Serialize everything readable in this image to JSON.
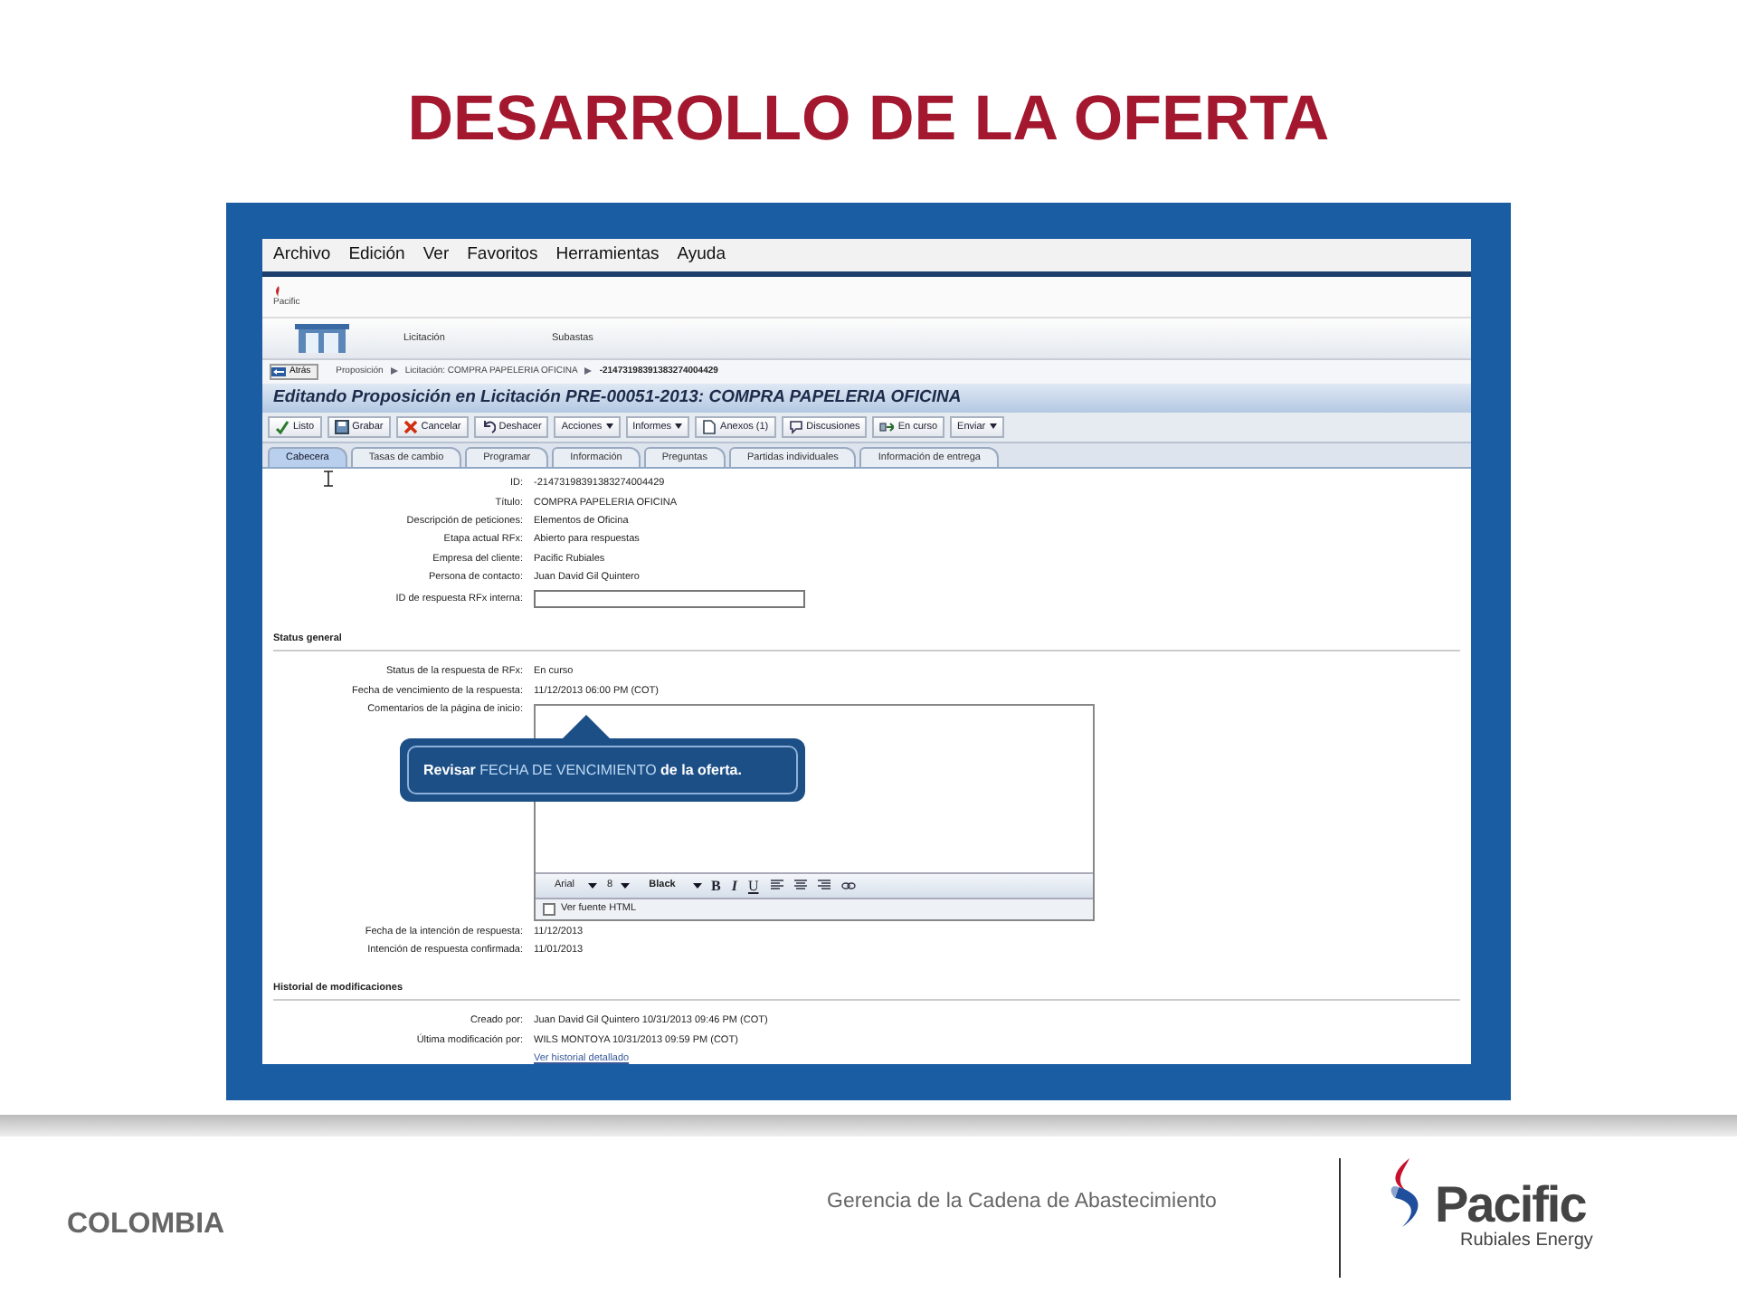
{
  "slide": {
    "title": "DESARROLLO DE LA OFERTA"
  },
  "app": {
    "menu": [
      "Archivo",
      "Edición",
      "Ver",
      "Favoritos",
      "Herramientas",
      "Ayuda"
    ],
    "logo_text": "Pacific",
    "nav": [
      "Licitación",
      "Subastas"
    ],
    "back_button": "Atrás",
    "breadcrumb": [
      "Proposición",
      "Licitación: COMPRA PAPELERIA OFICINA",
      "-21473198391383274004429"
    ],
    "page_title": "Editando Proposición en Licitación PRE-00051-2013: COMPRA PAPELERIA OFICINA",
    "toolbar": [
      {
        "label": "Listo",
        "dropdown": false
      },
      {
        "label": "Grabar",
        "dropdown": false
      },
      {
        "label": "Cancelar",
        "dropdown": false
      },
      {
        "label": "Deshacer",
        "dropdown": false
      },
      {
        "label": "Acciones",
        "dropdown": true
      },
      {
        "label": "Informes",
        "dropdown": true
      },
      {
        "label": "Anexos (1)",
        "dropdown": false
      },
      {
        "label": "Discusiones",
        "dropdown": false
      },
      {
        "label": "En curso",
        "dropdown": false
      },
      {
        "label": "Enviar",
        "dropdown": true
      }
    ],
    "tabs": [
      {
        "label": "Cabecera",
        "selected": true
      },
      {
        "label": "Tasas de cambio",
        "selected": false
      },
      {
        "label": "Programar",
        "selected": false
      },
      {
        "label": "Información",
        "selected": false
      },
      {
        "label": "Preguntas",
        "selected": false
      },
      {
        "label": "Partidas individuales",
        "selected": false
      },
      {
        "label": "Información de entrega",
        "selected": false
      }
    ],
    "header_fields": [
      {
        "label": "ID:",
        "value": "-21473198391383274004429"
      },
      {
        "label": "Título:",
        "value": "COMPRA PAPELERIA OFICINA"
      },
      {
        "label": "Descripción de peticiones:",
        "value": "Elementos de Oficina"
      },
      {
        "label": "Etapa actual RFx:",
        "value": "Abierto para respuestas"
      },
      {
        "label": "Empresa del cliente:",
        "value": "Pacific Rubiales"
      },
      {
        "label": "Persona de contacto:",
        "value": "Juan David Gil Quintero"
      },
      {
        "label": "ID de respuesta RFx interna:",
        "kind": "input"
      }
    ],
    "status_section": {
      "heading": "Status general",
      "fields": [
        {
          "label": "Status de la respuesta de RFx:",
          "value": "En curso"
        },
        {
          "label": "Fecha de vencimiento de la respuesta:",
          "value": "11/12/2013 06:00 PM (COT)"
        },
        {
          "label": "Comentarios de la página de inicio:",
          "kind": "editor"
        },
        {
          "label": "Fecha de la intención de respuesta:",
          "value": "11/12/2013"
        },
        {
          "label": "Intención de respuesta confirmada:",
          "value": "11/01/2013"
        }
      ]
    },
    "editor": {
      "font": "Arial",
      "size": "8",
      "text_color": "Black",
      "bold": "B",
      "italic": "I",
      "underline": "U",
      "html_source": {
        "label": "Ver fuente HTML",
        "checked": false
      }
    },
    "history_section": {
      "heading": "Historial de modificaciones",
      "fields": [
        {
          "label": "Creado por:",
          "value": "Juan David Gil Quintero 10/31/2013 09:46 PM (COT)"
        },
        {
          "label": "Última modificación por:",
          "value": "WILS MONTOYA 10/31/2013 09:59 PM (COT)"
        }
      ],
      "link": "Ver historial detallado"
    },
    "callout": [
      {
        "text": "Revisar",
        "highlight": false
      },
      {
        "text": "FECHA DE VENCIMIENTO",
        "highlight": true
      },
      {
        "text": "de la oferta.",
        "highlight": false
      }
    ]
  },
  "footer": {
    "country": "COLOMBIA",
    "department": "Gerencia de la Cadena de Abastecimiento",
    "logo_name": "Pacific",
    "logo_tagline": "Rubiales Energy"
  }
}
